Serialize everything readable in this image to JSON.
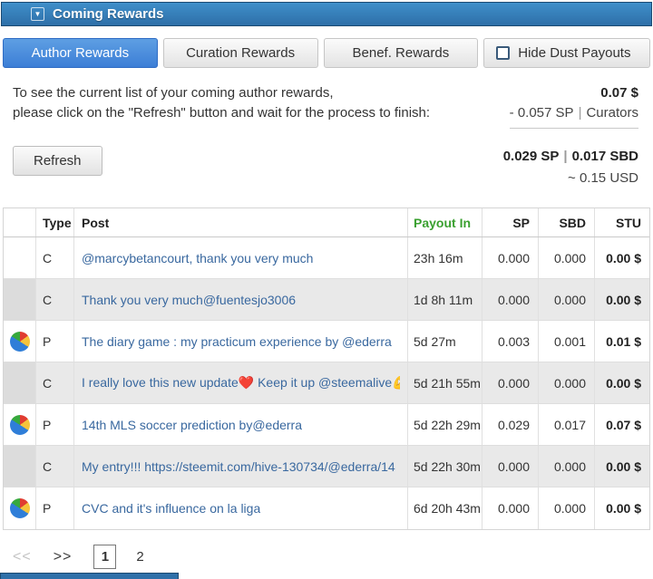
{
  "header": {
    "title": "Coming Rewards"
  },
  "tabs": [
    {
      "label": "Author Rewards",
      "active": true
    },
    {
      "label": "Curation Rewards",
      "active": false
    },
    {
      "label": "Benef. Rewards",
      "active": false
    }
  ],
  "hide_dust": {
    "label": "Hide Dust Payouts",
    "checked": false
  },
  "info": {
    "line1": "To see the current list of your coming author rewards,",
    "line2": "please click on the \"Refresh\" button and wait for the process to finish:",
    "total_usd": "0.07 $",
    "sp_deduction": "- 0.057 SP",
    "pipe": "|",
    "curators_label": "Curators"
  },
  "refresh": {
    "label": "Refresh"
  },
  "totals": {
    "sp": "0.029 SP",
    "pipe": "|",
    "sbd": "0.017 SBD",
    "usd": "~ 0.15 USD"
  },
  "table": {
    "headers": {
      "type": "Type",
      "post": "Post",
      "payout": "Payout In",
      "sp": "SP",
      "sbd": "SBD",
      "stu": "STU"
    },
    "rows": [
      {
        "icon": false,
        "type": "C",
        "post": "@marcybetancourt, thank you very much",
        "payout_in": "23h 16m",
        "sp": "0.000",
        "sbd": "0.000",
        "stu": "0.00 $"
      },
      {
        "icon": false,
        "type": "C",
        "post": "Thank you very much@fuentesjo3006",
        "payout_in": "1d 8h 11m",
        "sp": "0.000",
        "sbd": "0.000",
        "stu": "0.00 $"
      },
      {
        "icon": true,
        "type": "P",
        "post": "The diary game : my practicum experience by @ederra",
        "payout_in": "5d 27m",
        "sp": "0.003",
        "sbd": "0.001",
        "stu": "0.01 $"
      },
      {
        "icon": false,
        "type": "C",
        "post": "I really love this new update❤️ Keep it up @steemalive💪",
        "payout_in": "5d 21h 55m",
        "sp": "0.000",
        "sbd": "0.000",
        "stu": "0.00 $"
      },
      {
        "icon": true,
        "type": "P",
        "post": "14th MLS soccer prediction by@ederra",
        "payout_in": "5d 22h 29m",
        "sp": "0.029",
        "sbd": "0.017",
        "stu": "0.07 $"
      },
      {
        "icon": false,
        "type": "C",
        "post": "My entry!!! https://steemit.com/hive-130734/@ederra/14",
        "payout_in": "5d 22h 30m",
        "sp": "0.000",
        "sbd": "0.000",
        "stu": "0.00 $"
      },
      {
        "icon": true,
        "type": "P",
        "post": "CVC and it's influence on la liga",
        "payout_in": "6d 20h 43m",
        "sp": "0.000",
        "sbd": "0.000",
        "stu": "0.00 $"
      }
    ]
  },
  "pagination": {
    "first": "<<",
    "next": ">>",
    "pages": [
      "1",
      "2"
    ],
    "current": "1"
  },
  "colors": {
    "accent_blue": "#3f82d8",
    "header_blue": "#2e6fa8",
    "payout_green": "#3aa030",
    "link_blue": "#39689f"
  }
}
